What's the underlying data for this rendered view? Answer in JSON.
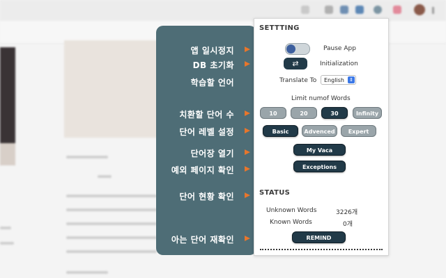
{
  "tooltip": {
    "rows": [
      {
        "label": "앱 일시정지"
      },
      {
        "label": "DB 초기화"
      },
      {
        "label": "학습할 언어"
      },
      {
        "label": "치환할 단어 수"
      },
      {
        "label": "단어 레벨 설정"
      },
      {
        "label": "단어장 열기"
      },
      {
        "label": "예외 페이지 확인"
      },
      {
        "label": "단어 현황 확인"
      },
      {
        "label": "아는 단어 재확인"
      }
    ],
    "arrow_color": "#e8762c"
  },
  "popup": {
    "settings_title": "SETTTING",
    "pause_label": "Pause App",
    "reset_label": "Initialization",
    "refresh_icon": "⇄",
    "translate_label": "Translate To",
    "language_value": "English",
    "limit_label": "Limit numof Words",
    "limit_options": [
      "10",
      "20",
      "30",
      "Infinity"
    ],
    "limit_selected": "30",
    "level_options": [
      "Basic",
      "Advenced",
      "Expert"
    ],
    "level_selected": "Basic",
    "myvaca_label": "My Vaca",
    "exceptions_label": "Exceptions",
    "status_title": "STATUS",
    "unknown_label": "Unknown Words",
    "unknown_value": "3226개",
    "known_label": "Known Words",
    "known_value": "0개",
    "remind_label": "REMIND"
  },
  "colors": {
    "panel": "#4e6d76",
    "button_dark": "#213a48",
    "button_light": "#9aa5aa"
  }
}
